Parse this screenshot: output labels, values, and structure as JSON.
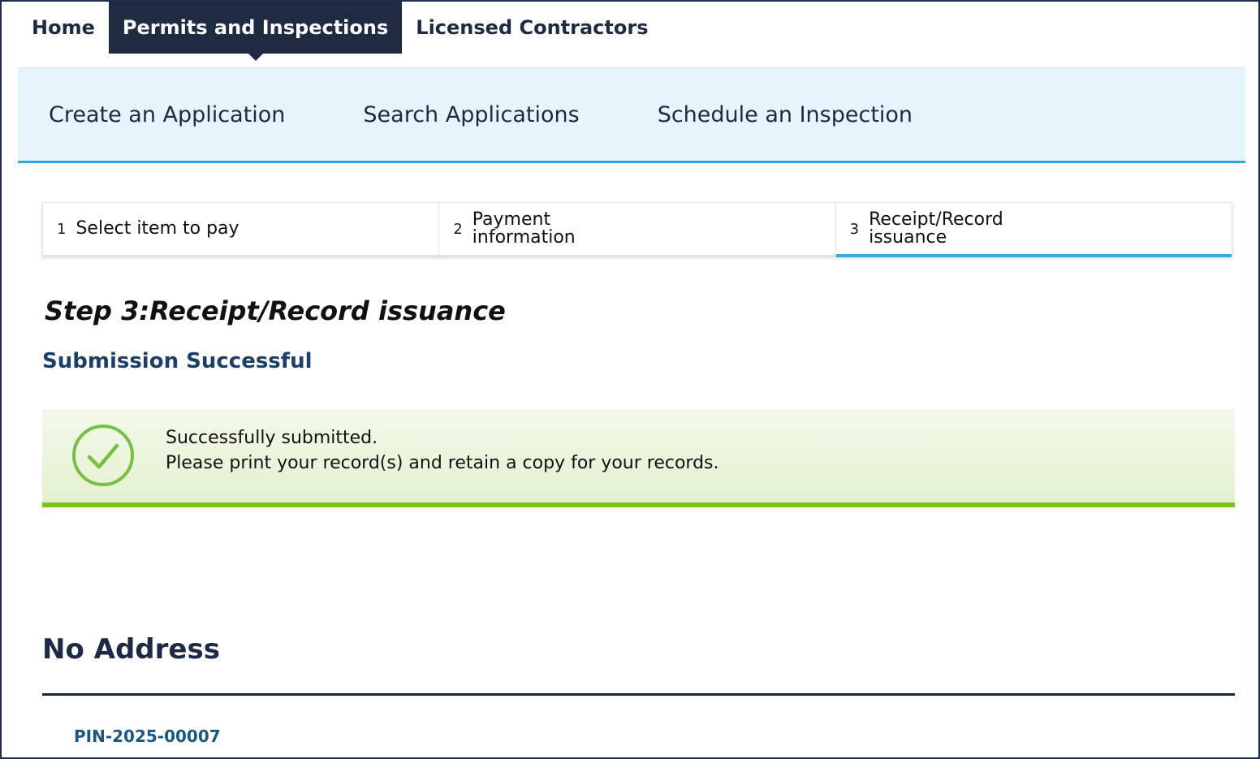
{
  "top_nav": {
    "tabs": [
      {
        "label": "Home"
      },
      {
        "label": "Permits and Inspections"
      },
      {
        "label": "Licensed Contractors"
      }
    ],
    "active_index": 1
  },
  "sub_nav": {
    "links": [
      {
        "label": "Create an Application"
      },
      {
        "label": "Search Applications"
      },
      {
        "label": "Schedule an Inspection"
      }
    ]
  },
  "stepper": {
    "steps": [
      {
        "number": "1",
        "label": "Select item to pay"
      },
      {
        "number": "2",
        "label": "Payment\ninformation"
      },
      {
        "number": "3",
        "label": "Receipt/Record\nissuance"
      }
    ],
    "active_index": 2
  },
  "main": {
    "step_title": "Step 3:Receipt/Record issuance",
    "subtitle": "Submission Successful",
    "banner": {
      "icon": "check-circle-icon",
      "line1": "Successfully submitted.",
      "line2": "Please print your record(s) and retain a copy for your records."
    },
    "address": "No Address",
    "record_id": "PIN-2025-00007"
  },
  "colors": {
    "nav_dark": "#1e2b40",
    "subnav_bg": "#e6f4fb",
    "accent_blue": "#3aa8e4",
    "success_green": "#7dc11d",
    "link_blue": "#1c5782"
  }
}
